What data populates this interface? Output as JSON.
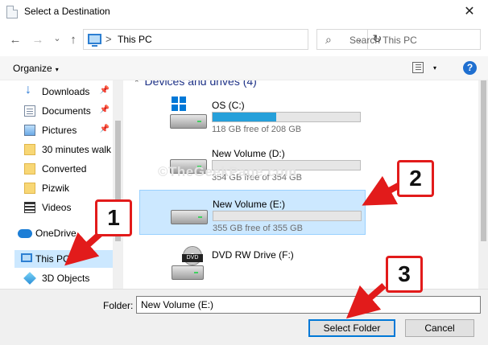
{
  "window": {
    "title": "Select a Destination",
    "close_glyph": "✕"
  },
  "nav": {
    "back": "←",
    "forward": "→",
    "recent": "⌄",
    "up": "↑"
  },
  "address": {
    "separator": ">",
    "location": "This PC",
    "dropdown": "⌄",
    "refresh": "↻"
  },
  "search": {
    "placeholder": "Search This PC",
    "icon": "⌕"
  },
  "toolbar": {
    "organize_label": "Organize",
    "caret": "▾",
    "views_caret": "▾",
    "help": "?"
  },
  "sidebar": {
    "items": [
      {
        "label": "Downloads",
        "icon": "download-icon",
        "pinned": true
      },
      {
        "label": "Documents",
        "icon": "documents-icon",
        "pinned": true
      },
      {
        "label": "Pictures",
        "icon": "pictures-icon",
        "pinned": true
      },
      {
        "label": "30 minutes walk",
        "icon": "folder-icon"
      },
      {
        "label": "Converted",
        "icon": "folder-icon"
      },
      {
        "label": "Pizwik",
        "icon": "folder-icon"
      },
      {
        "label": "Videos",
        "icon": "videos-icon"
      },
      {
        "label": "OneDrive",
        "icon": "onedrive-icon"
      },
      {
        "label": "This PC",
        "icon": "this-pc-icon",
        "selected": true
      },
      {
        "label": "3D Objects",
        "icon": "3d-objects-icon"
      }
    ],
    "pin_glyph": "📌"
  },
  "main": {
    "group_title": "Devices and drives (4)",
    "chevron": "⌃",
    "drives": [
      {
        "name": "OS (C:)",
        "free_text": "118 GB free of 208 GB",
        "used_fraction": 0.43
      },
      {
        "name": "New Volume (D:)",
        "free_text": "354 GB free of 354 GB",
        "used_fraction": 0.0
      },
      {
        "name": "New Volume (E:)",
        "free_text": "355 GB free of 355 GB",
        "used_fraction": 0.0,
        "selected": true
      },
      {
        "name": "DVD RW Drive (F:)",
        "dvd_label": "DVD"
      }
    ]
  },
  "watermark": "©TheGeekPage.com",
  "footer": {
    "folder_label": "Folder:",
    "folder_value": "New Volume (E:)",
    "select_button": "Select Folder",
    "cancel_button": "Cancel"
  },
  "callouts": [
    "1",
    "2",
    "3"
  ],
  "colors": {
    "accent": "#0078d7",
    "selection": "#cce8ff",
    "drive_fill": "#26a0da",
    "callout_red": "#e21b1b"
  }
}
